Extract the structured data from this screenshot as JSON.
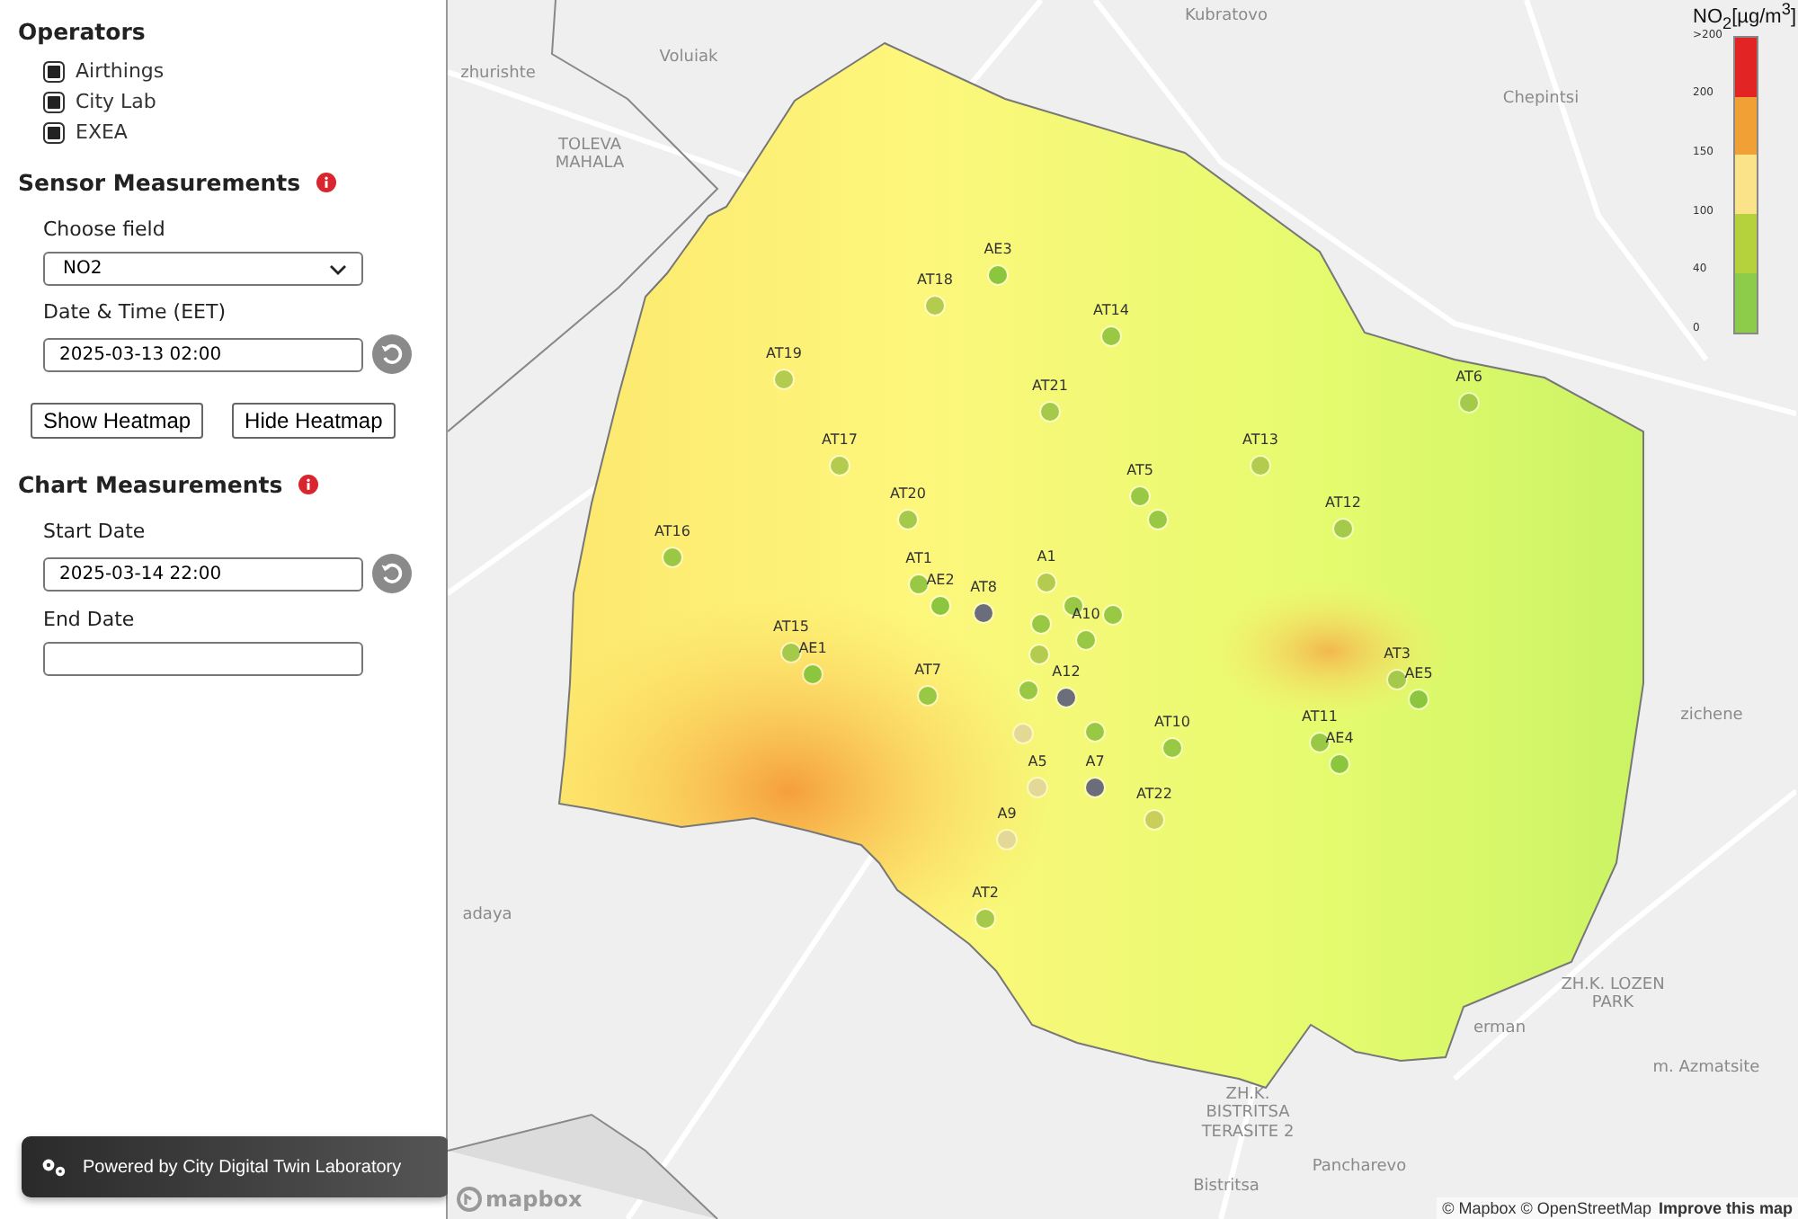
{
  "sidebar": {
    "operators": {
      "title": "Operators",
      "items": [
        {
          "label": "Airthings",
          "checked": true
        },
        {
          "label": "City Lab",
          "checked": true
        },
        {
          "label": "EXEA",
          "checked": true
        }
      ]
    },
    "sensor_measurements": {
      "title": "Sensor Measurements",
      "field_label": "Choose field",
      "field_value": "NO2",
      "datetime_label": "Date & Time (EET)",
      "datetime_value": "2025-03-13 02:00",
      "buttons": [
        "Show Heatmap",
        "Hide Heatmap"
      ]
    },
    "chart_measurements": {
      "title": "Chart Measurements",
      "start_label": "Start Date",
      "start_value": "2025-03-14 22:00",
      "end_label": "End Date"
    },
    "footer": "Powered by City Digital Twin Laboratory"
  },
  "map": {
    "places": [
      "Kubratovo",
      "Voluiak",
      "Chepintsi",
      "zhurishte",
      "TOLEVA MAHALA",
      "adaya",
      "zichene",
      "erman",
      "ZH.K. LOZEN PARK",
      "m. Azmatsite",
      "ZH.K. BISTRITSA TERASITE 2",
      "Pancharevo",
      "Bistritsa"
    ],
    "sensors": [
      {
        "label": "AE3",
        "color": "#8cc63f"
      },
      {
        "label": "AT18",
        "color": "#b3cc4f"
      },
      {
        "label": "AT14",
        "color": "#99c845"
      },
      {
        "label": "AT19",
        "color": "#b3cc4f"
      },
      {
        "label": "AT21",
        "color": "#a5c94a"
      },
      {
        "label": "AT6",
        "color": "#a5c94a"
      },
      {
        "label": "AT17",
        "color": "#b3cc4f"
      },
      {
        "label": "AT13",
        "color": "#b3cc4f"
      },
      {
        "label": "AT5",
        "color": "#99c845"
      },
      {
        "color": "#99c845"
      },
      {
        "label": "AT12",
        "color": "#a5c94a"
      },
      {
        "label": "AT20",
        "color": "#a5c94a"
      },
      {
        "label": "AT16",
        "color": "#99c845"
      },
      {
        "label": "A1",
        "color": "#b3cc4f"
      },
      {
        "label": "AT1",
        "color": "#99c845"
      },
      {
        "label": "AE2",
        "color": "#8cc63f"
      },
      {
        "label": "AT8",
        "color": "#6b6d7a"
      },
      {
        "color": "#99c845"
      },
      {
        "color": "#99c845"
      },
      {
        "color": "#99c845"
      },
      {
        "label": "A10",
        "color": "#99c845"
      },
      {
        "color": "#b3cc4f"
      },
      {
        "label": "AT15",
        "color": "#a5c94a"
      },
      {
        "label": "AE1",
        "color": "#8cc63f"
      },
      {
        "label": "AT7",
        "color": "#99c845"
      },
      {
        "color": "#99c845"
      },
      {
        "label": "A12",
        "color": "#6b6d7a"
      },
      {
        "label": "AT3",
        "color": "#a5c94a"
      },
      {
        "label": "AE5",
        "color": "#8cc63f"
      },
      {
        "color": "#e4d896"
      },
      {
        "color": "#99c845"
      },
      {
        "label": "AT10",
        "color": "#99c845"
      },
      {
        "label": "AT11",
        "color": "#99c845"
      },
      {
        "label": "AE4",
        "color": "#8cc63f"
      },
      {
        "label": "A5",
        "color": "#e4d896"
      },
      {
        "label": "A7",
        "color": "#6b6d7a"
      },
      {
        "label": "AT22",
        "color": "#c9cf5a"
      },
      {
        "label": "A9",
        "color": "#e4d896"
      },
      {
        "label": "AT2",
        "color": "#a5c94a"
      }
    ],
    "legend": {
      "title": "NO$_{2}$[µg/m$^{3}$]",
      "ticks": [
        ">200",
        "200",
        "150",
        "100",
        "40",
        "0"
      ],
      "segments": [
        {
          "color": "#e32424"
        },
        {
          "color": "#f0a035"
        },
        {
          "color": "#fbe38a"
        },
        {
          "color": "#b5d23c"
        },
        {
          "color": "#8dcc4a"
        }
      ]
    },
    "logo": "mapbox",
    "attribution": "© Mapbox © OpenStreetMap",
    "improve_link": "Improve this map"
  }
}
